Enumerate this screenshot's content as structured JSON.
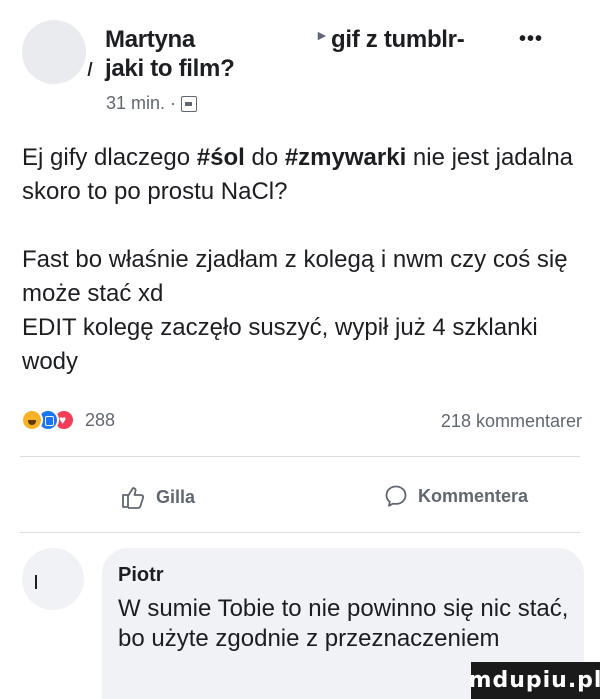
{
  "post": {
    "author": "Martyna",
    "group": "gif z tumblr-",
    "more_icon": "ellipsis-icon",
    "subtitle": "jaki to film?",
    "time": "31 min.",
    "audience_icon": "group-privacy-icon",
    "body": [
      [
        {
          "text": "Ej gify dlaczego ",
          "bold": false
        },
        {
          "text": "#śol",
          "bold": true
        },
        {
          "text": " do ",
          "bold": false
        },
        {
          "text": "#zmywarki",
          "bold": true
        },
        {
          "text": " nie jest jadalna skoro to po prostu NaCl?",
          "bold": false
        }
      ],
      [
        {
          "text": "Fast bo właśnie zjadłam z kolegą i nwm czy coś się może stać xd\nEDIT kolegę zaczęło suszyć, wypił już 4 szklanki wody",
          "bold": false
        }
      ]
    ]
  },
  "reactions": {
    "types": [
      "haha",
      "like",
      "love"
    ],
    "count": "288",
    "comments": "218 kommentarer"
  },
  "actions": {
    "like_label": "Gilla",
    "like_icon": "thumbs-up-icon",
    "comment_label": "Kommentera",
    "comment_icon": "speech-bubble-icon"
  },
  "comment": {
    "author": "Piotr",
    "text": "W sumie Tobie to nie powinno się nic stać, bo użyte zgodnie z przeznaczeniem"
  },
  "watermark": "mdupiu.pl",
  "colors": {
    "text": "#1c1e21",
    "secondary": "#606770",
    "bubble": "#f0f2f5",
    "like_blue": "#1877f2",
    "love_red": "#f33e58",
    "haha_yellow": "#f7b125"
  }
}
